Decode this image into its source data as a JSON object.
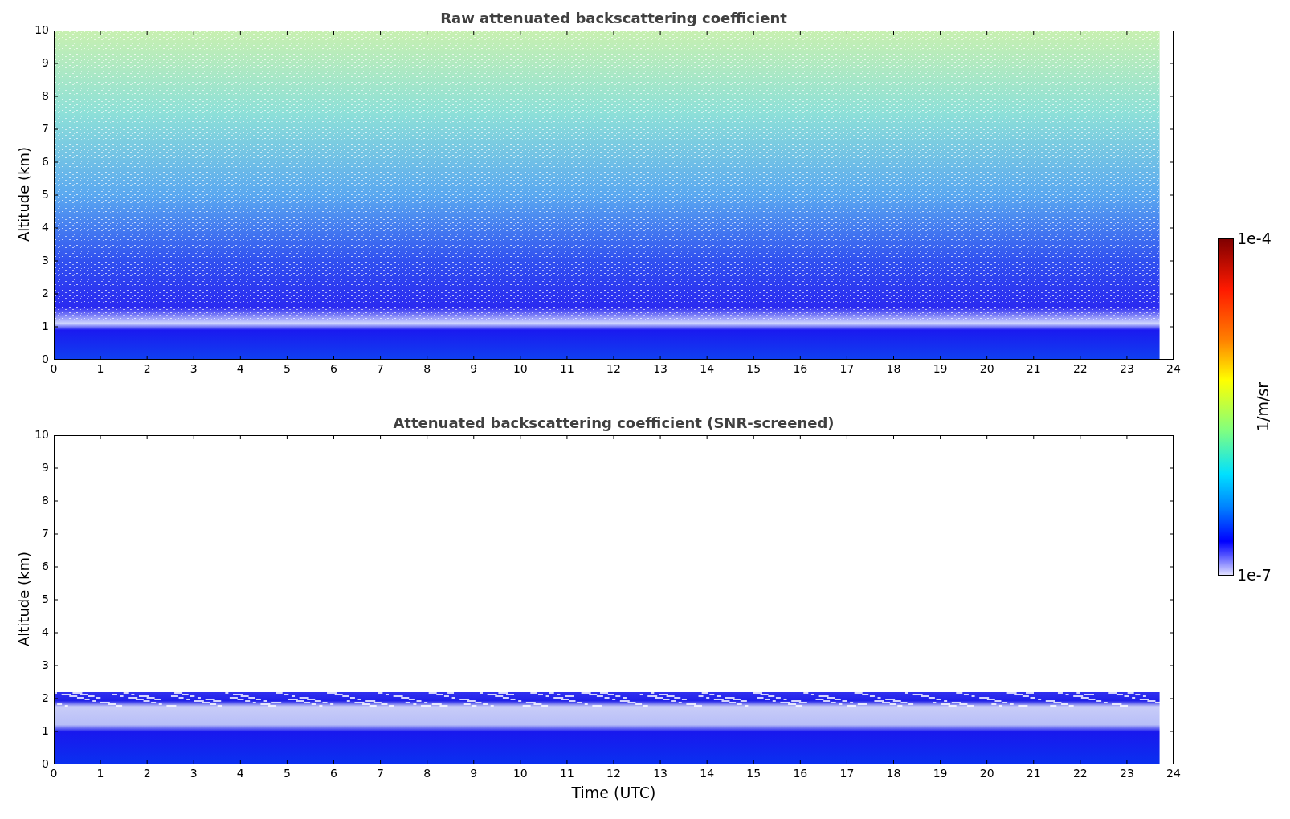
{
  "plots": [
    {
      "title": "Raw attenuated backscattering coefficient",
      "kind": "raw",
      "ylabel": "Altitude (km)",
      "yticks": [
        "10",
        "9",
        "8",
        "7",
        "6",
        "5",
        "4",
        "3",
        "2",
        "1",
        "0"
      ],
      "xticks": [
        "0",
        "1",
        "2",
        "3",
        "4",
        "5",
        "6",
        "7",
        "8",
        "9",
        "10",
        "11",
        "12",
        "13",
        "14",
        "15",
        "16",
        "17",
        "18",
        "19",
        "20",
        "21",
        "22",
        "23",
        "24"
      ]
    },
    {
      "title": "Attenuated backscattering coefficient (SNR-screened)",
      "kind": "screened",
      "ylabel": "Altitude (km)",
      "yticks": [
        "10",
        "9",
        "8",
        "7",
        "6",
        "5",
        "4",
        "3",
        "2",
        "1",
        "0"
      ],
      "xticks": [
        "0",
        "1",
        "2",
        "3",
        "4",
        "5",
        "6",
        "7",
        "8",
        "9",
        "10",
        "11",
        "12",
        "13",
        "14",
        "15",
        "16",
        "17",
        "18",
        "19",
        "20",
        "21",
        "22",
        "23",
        "24"
      ],
      "xlabel": "Time (UTC)"
    }
  ],
  "colorbar": {
    "top_label": "1e-4",
    "bottom_label": "1e-7",
    "unit": "1/m/sr"
  }
}
